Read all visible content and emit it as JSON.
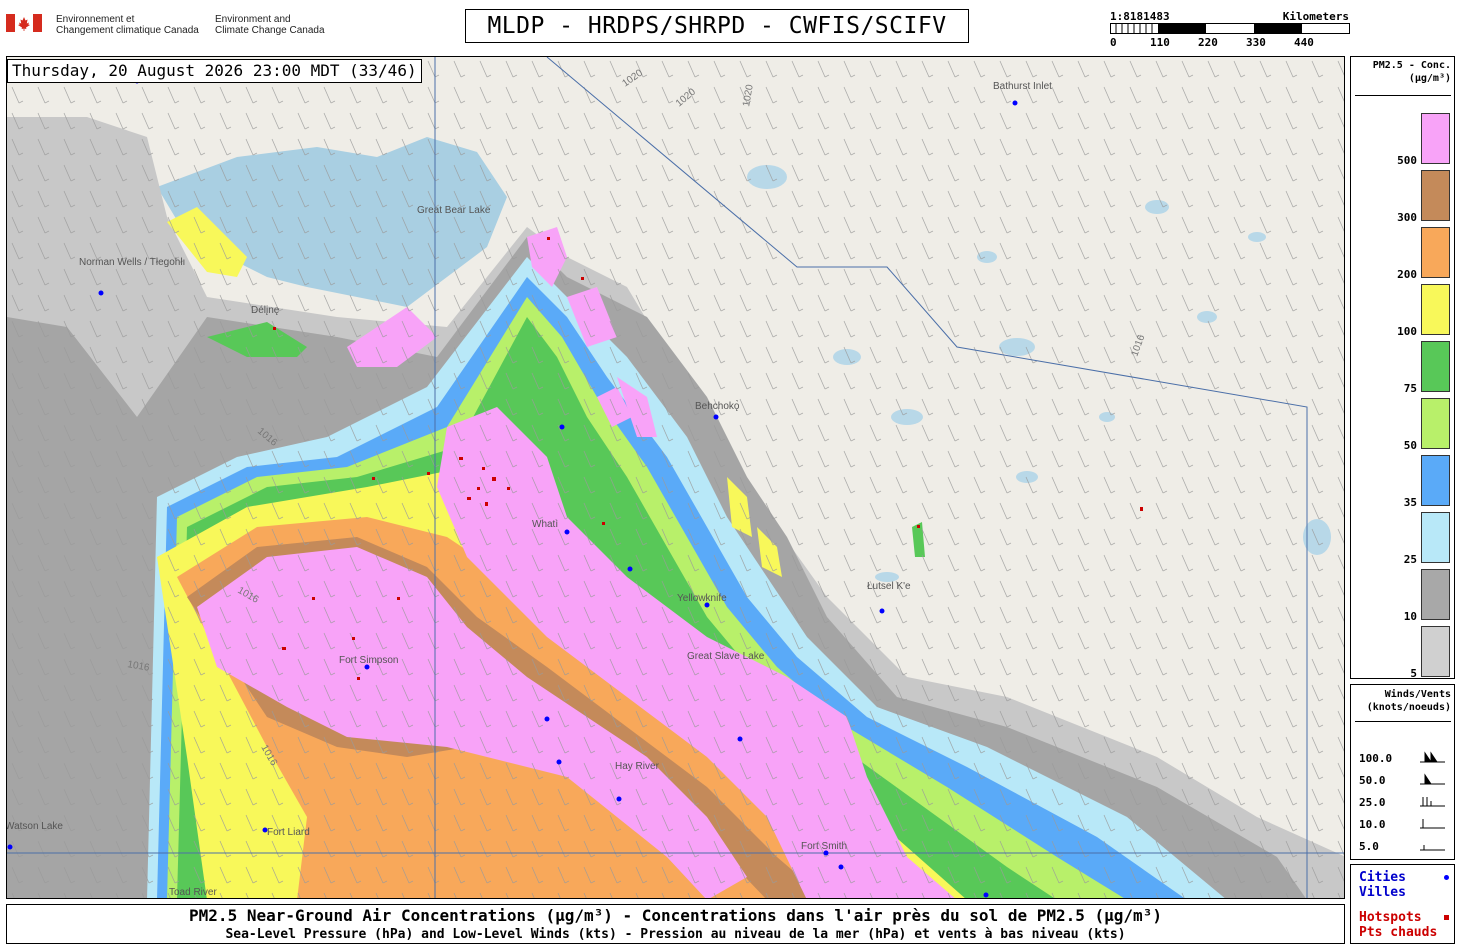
{
  "header": {
    "dept_fr": [
      "Environnement et",
      "Changement climatique Canada"
    ],
    "dept_en": [
      "Environment and",
      "Climate Change Canada"
    ],
    "title": "MLDP - HRDPS/SHRPD - CWFIS/SCIFV"
  },
  "scale": {
    "ratio": "1:8181483",
    "unit": "Kilometers",
    "ticks": [
      "0",
      "110",
      "220",
      "330",
      "440"
    ]
  },
  "map": {
    "datetime": "Thursday, 20 August 2026 23:00 MDT (33/46)",
    "places": [
      "Bathurst Inlet",
      "Great Bear Lake",
      "Norman Wells / Tłegohłı",
      "Délįnę",
      "Whatì",
      "Yellowknife",
      "Great Slave Lake",
      "Łutsel K'e",
      "Hay River",
      "Fort Smith",
      "Fort Liard",
      "Toad River",
      "Watson Lake",
      "Behchokǫ̀",
      "Fort Simpson"
    ],
    "isobars": [
      "1020",
      "1020",
      "1020",
      "1016",
      "1016",
      "1016",
      "1016",
      "1016"
    ]
  },
  "legend": {
    "title": [
      "PM2.5 - Conc.",
      "(µg/m³)"
    ],
    "levels": [
      {
        "label": "500",
        "color": "#f8a3f8"
      },
      {
        "label": "300",
        "color": "#c48a5a"
      },
      {
        "label": "200",
        "color": "#f8a85a"
      },
      {
        "label": "100",
        "color": "#f8f85a"
      },
      {
        "label": "75",
        "color": "#58c858"
      },
      {
        "label": "50",
        "color": "#b8f06a"
      },
      {
        "label": "35",
        "color": "#5aaaf8"
      },
      {
        "label": "25",
        "color": "#b8e8f8"
      },
      {
        "label": "10",
        "color": "#a8a8a8"
      },
      {
        "label": "5",
        "color": "#d0d0d0"
      }
    ]
  },
  "wind_legend": {
    "title": [
      "Winds/Vents",
      "(knots/noeuds)"
    ],
    "rows": [
      "100.0",
      "50.0",
      "25.0",
      "10.0",
      "5.0"
    ]
  },
  "cities_legend": {
    "cities": [
      "Cities",
      "Villes"
    ],
    "hotspots": [
      "Hotspots",
      "Pts chauds"
    ],
    "city_color": "#0000ff",
    "hotspot_color": "#cc0000"
  },
  "footer": {
    "line1": "PM2.5 Near-Ground Air Concentrations (µg/m³) - Concentrations dans l'air près du sol de PM2.5 (µg/m³)",
    "line2": "Sea-Level Pressure (hPa) and Low-Level Winds (kts) - Pression au niveau de la mer (hPa) et vents à bas niveau (kts)"
  }
}
